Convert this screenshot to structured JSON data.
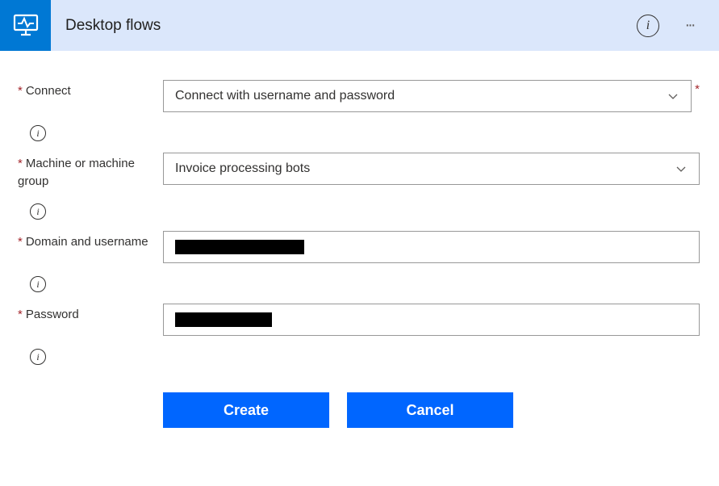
{
  "header": {
    "title": "Desktop flows"
  },
  "form": {
    "connect": {
      "label": "Connect",
      "value": "Connect with username and password"
    },
    "machine": {
      "label": "Machine or machine group",
      "value": "Invoice processing bots"
    },
    "domain": {
      "label": "Domain and username",
      "value": "redacted"
    },
    "password": {
      "label": "Password",
      "value": "redacted"
    }
  },
  "buttons": {
    "create": "Create",
    "cancel": "Cancel"
  }
}
